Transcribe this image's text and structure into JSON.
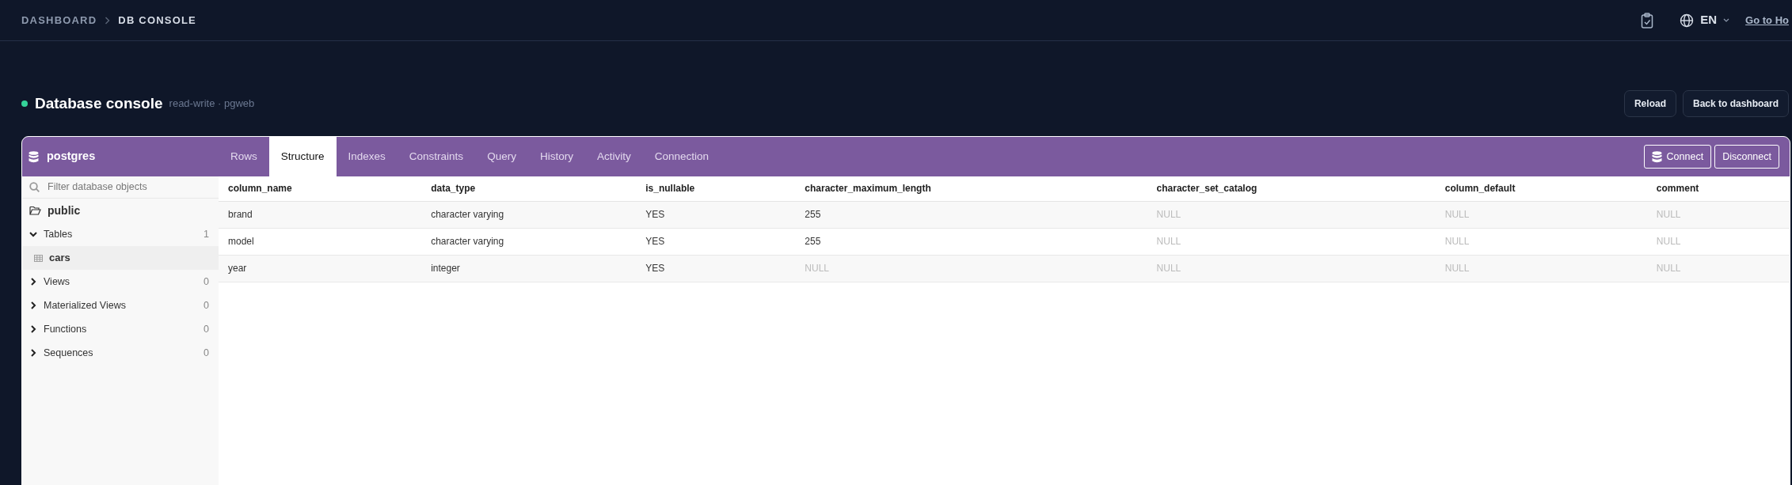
{
  "breadcrumb": [
    {
      "label": "DASHBOARD",
      "current": false
    },
    {
      "label": "DB CONSOLE",
      "current": true
    }
  ],
  "topbar": {
    "language": "EN",
    "home_link": "Go to Ho"
  },
  "page": {
    "title": "Database console",
    "status_online": true,
    "subtitle": "read-write · pgweb",
    "buttons": [
      "Reload",
      "Back to dashboard"
    ]
  },
  "console": {
    "database": "postgres",
    "tabs": [
      {
        "label": "Rows",
        "selected": false
      },
      {
        "label": "Structure",
        "selected": true
      },
      {
        "label": "Indexes",
        "selected": false
      },
      {
        "label": "Constraints",
        "selected": false
      },
      {
        "label": "Query",
        "selected": false
      },
      {
        "label": "History",
        "selected": false
      },
      {
        "label": "Activity",
        "selected": false
      },
      {
        "label": "Connection",
        "selected": false
      }
    ],
    "actions": [
      {
        "label": "Connect",
        "kind": "connect"
      },
      {
        "label": "Disconnect",
        "kind": "plain"
      }
    ],
    "sidebar": {
      "filter_placeholder": "Filter database objects",
      "schema": "public",
      "groups": [
        {
          "label": "Tables",
          "count": "1",
          "expanded": true,
          "children": [
            {
              "label": "cars",
              "selected": true
            }
          ]
        },
        {
          "label": "Views",
          "count": "0",
          "expanded": false
        },
        {
          "label": "Materialized Views",
          "count": "0",
          "expanded": false
        },
        {
          "label": "Functions",
          "count": "0",
          "expanded": false
        },
        {
          "label": "Sequences",
          "count": "0",
          "expanded": false
        }
      ]
    },
    "table": {
      "columns": [
        "column_name",
        "data_type",
        "is_nullable",
        "character_maximum_length",
        "character_set_catalog",
        "column_default",
        "comment"
      ],
      "rows": [
        [
          {
            "text": "brand",
            "null": false
          },
          {
            "text": "character varying",
            "null": false
          },
          {
            "text": "YES",
            "null": false
          },
          {
            "text": "255",
            "null": false
          },
          {
            "text": "NULL",
            "null": true
          },
          {
            "text": "NULL",
            "null": true
          },
          {
            "text": "NULL",
            "null": true
          }
        ],
        [
          {
            "text": "model",
            "null": false
          },
          {
            "text": "character varying",
            "null": false
          },
          {
            "text": "YES",
            "null": false
          },
          {
            "text": "255",
            "null": false
          },
          {
            "text": "NULL",
            "null": true
          },
          {
            "text": "NULL",
            "null": true
          },
          {
            "text": "NULL",
            "null": true
          }
        ],
        [
          {
            "text": "year",
            "null": false
          },
          {
            "text": "integer",
            "null": false
          },
          {
            "text": "YES",
            "null": false
          },
          {
            "text": "NULL",
            "null": true
          },
          {
            "text": "NULL",
            "null": true
          },
          {
            "text": "NULL",
            "null": true
          },
          {
            "text": "NULL",
            "null": true
          }
        ]
      ]
    }
  }
}
